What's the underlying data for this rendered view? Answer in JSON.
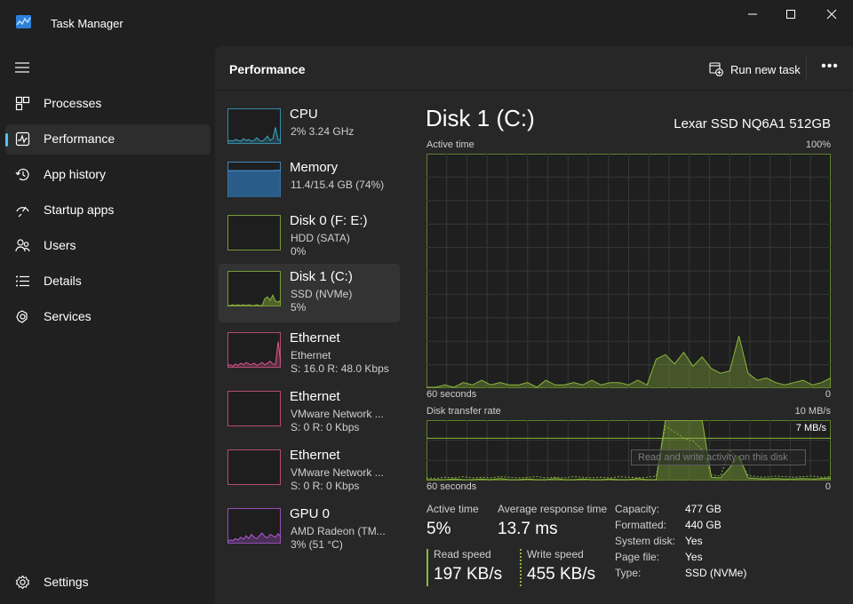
{
  "window": {
    "title": "Task Manager"
  },
  "nav": {
    "items": [
      {
        "label": "Processes",
        "icon": "processes-icon"
      },
      {
        "label": "Performance",
        "icon": "performance-icon",
        "active": true
      },
      {
        "label": "App history",
        "icon": "app-history-icon"
      },
      {
        "label": "Startup apps",
        "icon": "startup-apps-icon"
      },
      {
        "label": "Users",
        "icon": "users-icon"
      },
      {
        "label": "Details",
        "icon": "details-icon"
      },
      {
        "label": "Services",
        "icon": "services-icon"
      }
    ],
    "settings_label": "Settings"
  },
  "header": {
    "title": "Performance",
    "run_new_task": "Run new task",
    "more": "•••"
  },
  "devices": [
    {
      "name": "CPU",
      "sub1": "2%  3.24 GHz",
      "sub2": ""
    },
    {
      "name": "Memory",
      "sub1": "11.4/15.4 GB (74%)",
      "sub2": ""
    },
    {
      "name": "Disk 0 (F: E:)",
      "sub1": "HDD (SATA)",
      "sub2": "0%"
    },
    {
      "name": "Disk 1 (C:)",
      "sub1": "SSD (NVMe)",
      "sub2": "5%"
    },
    {
      "name": "Ethernet",
      "sub1": "Ethernet",
      "sub2": "S: 16.0  R: 48.0 Kbps"
    },
    {
      "name": "Ethernet",
      "sub1": "VMware Network ...",
      "sub2": "S: 0  R: 0 Kbps"
    },
    {
      "name": "Ethernet",
      "sub1": "VMware Network ...",
      "sub2": "S: 0  R: 0 Kbps"
    },
    {
      "name": "GPU 0",
      "sub1": "AMD Radeon (TM...",
      "sub2": "3%  (51 °C)"
    }
  ],
  "detail": {
    "title": "Disk 1 (C:)",
    "model": "Lexar SSD NQ6A1 512GB",
    "active_time_graph": {
      "label": "Active time",
      "max_label": "100%",
      "time_label": "60 seconds",
      "min_label": "0",
      "values_percent": [
        0,
        0,
        1,
        0,
        2,
        1,
        3,
        1,
        2,
        1,
        1,
        2,
        0,
        3,
        1,
        1,
        2,
        1,
        3,
        1,
        2,
        2,
        1,
        3,
        1,
        12,
        14,
        10,
        15,
        9,
        13,
        8,
        6,
        7,
        22,
        6,
        3,
        4,
        2,
        1,
        2,
        3,
        1,
        2,
        4
      ]
    },
    "transfer_graph": {
      "label": "Disk transfer rate",
      "max_label": "10 MB/s",
      "ref_label": "7 MB/s",
      "time_label": "60 seconds",
      "min_label": "0",
      "tooltip": "Read and write activity on this disk",
      "read_mbps": [
        0,
        0,
        0,
        0.1,
        0,
        0,
        0.1,
        0,
        0.2,
        0,
        0,
        0.1,
        0,
        0,
        0.2,
        0,
        0,
        0.1,
        0,
        0,
        0.1,
        0,
        0,
        0.2,
        0,
        0,
        10,
        10,
        10,
        10,
        10,
        0.4,
        0.3,
        2,
        4,
        0.3,
        0.2,
        0.1,
        0.2,
        0.1,
        0.1,
        0.2,
        0.1,
        0.2,
        0.3
      ],
      "write_mbps": [
        0.3,
        0.2,
        0.4,
        0.3,
        0.5,
        0.3,
        0.4,
        0.3,
        0.5,
        0.4,
        0.3,
        0.4,
        0.5,
        0.3,
        0.4,
        0.3,
        0.5,
        0.4,
        0.3,
        0.4,
        0.3,
        0.5,
        0.4,
        0.3,
        0.4,
        0.6,
        9,
        8,
        7,
        6.5,
        5,
        0.8,
        0.6,
        5,
        3.5,
        0.7,
        0.5,
        0.4,
        0.6,
        0.5,
        0.4,
        0.5,
        0.6,
        0.4,
        0.5
      ]
    },
    "stats": {
      "active_time_label": "Active time",
      "active_time_value": "5%",
      "avg_response_label": "Average response time",
      "avg_response_value": "13.7 ms",
      "read_speed_label": "Read speed",
      "read_speed_value": "197 KB/s",
      "write_speed_label": "Write speed",
      "write_speed_value": "455 KB/s"
    },
    "properties": [
      {
        "key": "Capacity:",
        "value": "477 GB"
      },
      {
        "key": "Formatted:",
        "value": "440 GB"
      },
      {
        "key": "System disk:",
        "value": "Yes"
      },
      {
        "key": "Page file:",
        "value": "Yes"
      },
      {
        "key": "Type:",
        "value": "SSD (NVMe)"
      }
    ]
  },
  "colors": {
    "disk_green": "#8cb73c",
    "memory_blue": "#4b9ce0",
    "ethernet_pink": "#d9578a",
    "gpu_purple": "#b35ad9",
    "cpu_teal": "#3aa6c8",
    "accent": "#4cc2ff"
  }
}
